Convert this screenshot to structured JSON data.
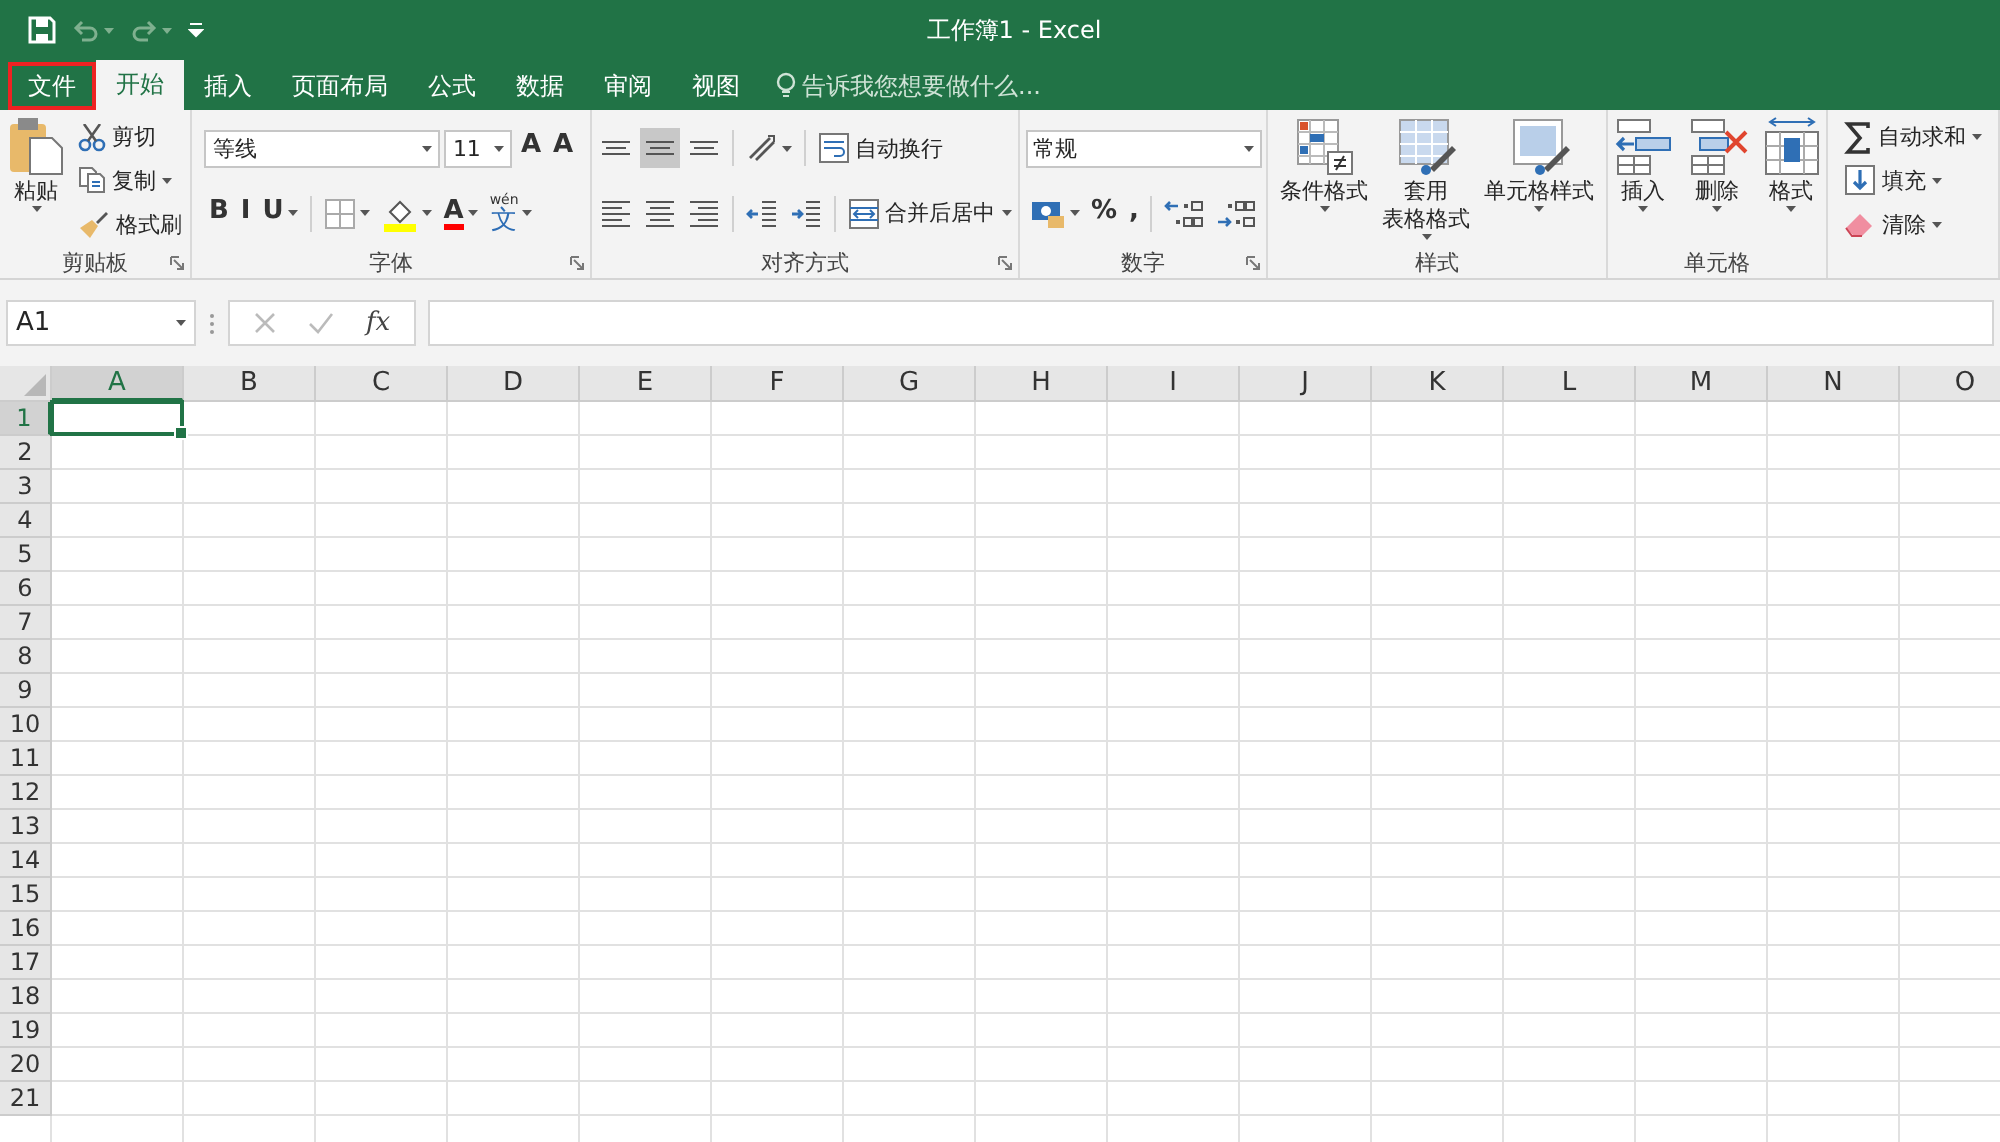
{
  "title_bar": {
    "title": "工作簿1 - Excel",
    "undo_disabled": true,
    "redo_disabled": true
  },
  "tabs": [
    {
      "label": "文件",
      "selected": false,
      "highlighted": true
    },
    {
      "label": "开始",
      "selected": true,
      "highlighted": false
    },
    {
      "label": "插入",
      "selected": false,
      "highlighted": false
    },
    {
      "label": "页面布局",
      "selected": false,
      "highlighted": false
    },
    {
      "label": "公式",
      "selected": false,
      "highlighted": false
    },
    {
      "label": "数据",
      "selected": false,
      "highlighted": false
    },
    {
      "label": "审阅",
      "selected": false,
      "highlighted": false
    },
    {
      "label": "视图",
      "selected": false,
      "highlighted": false
    }
  ],
  "tell_me": {
    "placeholder": "告诉我您想要做什么..."
  },
  "ribbon": [
    {
      "label": "剪贴板",
      "launcher": true,
      "columns": [
        {
          "kind": "large",
          "label": "粘贴",
          "dropdown": true
        },
        {
          "kind": "stack",
          "lines": [
            [
              {
                "kind": "small",
                "label": "剪切",
                "dropdown": false
              }
            ],
            [
              {
                "kind": "small",
                "label": "复制",
                "dropdown": true
              }
            ],
            [
              {
                "kind": "small",
                "label": "格式刷",
                "dropdown": false
              }
            ]
          ]
        }
      ]
    },
    {
      "label": "字体",
      "launcher": true,
      "columns": [
        {
          "kind": "stack",
          "lines": [
            [
              {
                "kind": "field",
                "value": "等线",
                "dropdown": true,
                "wide": true
              },
              {
                "kind": "field",
                "value": "11",
                "dropdown": true,
                "wide": false
              },
              {
                "kind": "glyph",
                "text": "A",
                "dropdown": false
              },
              {
                "kind": "glyph",
                "text": "A",
                "dropdown": false
              }
            ],
            [
              {
                "kind": "glyph",
                "text": "B",
                "dropdown": false
              },
              {
                "kind": "glyph",
                "text": "I",
                "dropdown": false
              },
              {
                "kind": "glyph",
                "text": "U",
                "dropdown": true
              },
              {
                "kind": "separator"
              },
              {
                "kind": "icon",
                "dropdown": true
              },
              {
                "kind": "icon",
                "dropdown": true,
                "color": "#ffff00"
              },
              {
                "kind": "glyph",
                "text": "A",
                "dropdown": true,
                "color": "#ff0000"
              },
              {
                "kind": "ruby",
                "text": "文",
                "ruby": "wén",
                "dropdown": true
              }
            ]
          ]
        }
      ]
    },
    {
      "label": "对齐方式",
      "launcher": true,
      "columns": [
        {
          "kind": "stack",
          "lines": [
            [
              {
                "kind": "icon",
                "dropdown": false,
                "selected": false
              },
              {
                "kind": "icon",
                "dropdown": false,
                "selected": true
              },
              {
                "kind": "icon",
                "dropdown": false,
                "selected": false
              },
              {
                "kind": "separator"
              },
              {
                "kind": "icon",
                "dropdown": true
              },
              {
                "kind": "separator"
              },
              {
                "kind": "small",
                "label": "自动换行",
                "dropdown": false
              }
            ],
            [
              {
                "kind": "icon",
                "dropdown": false,
                "selected": false
              },
              {
                "kind": "icon",
                "dropdown": false,
                "selected": false
              },
              {
                "kind": "icon",
                "dropdown": false,
                "selected": false
              },
              {
                "kind": "separator"
              },
              {
                "kind": "icon",
                "dropdown": false
              },
              {
                "kind": "icon",
                "dropdown": false
              },
              {
                "kind": "separator"
              },
              {
                "kind": "small",
                "label": "合并后居中",
                "dropdown": true
              }
            ]
          ]
        }
      ]
    },
    {
      "label": "数字",
      "launcher": true,
      "columns": [
        {
          "kind": "stack",
          "lines": [
            [
              {
                "kind": "field",
                "value": "常规",
                "dropdown": true,
                "wide": true
              }
            ],
            [
              {
                "kind": "icon",
                "dropdown": true
              },
              {
                "kind": "glyph",
                "text": "%",
                "dropdown": false
              },
              {
                "kind": "glyph",
                "text": ",",
                "dropdown": false
              },
              {
                "kind": "separator"
              },
              {
                "kind": "icon",
                "dropdown": false
              },
              {
                "kind": "icon",
                "dropdown": false
              }
            ]
          ]
        }
      ]
    },
    {
      "label": "样式",
      "launcher": false,
      "columns": [
        {
          "kind": "large",
          "label": "条件格式",
          "dropdown": true
        },
        {
          "kind": "large",
          "label": "套用",
          "label_2": "表格格式",
          "dropdown": true
        },
        {
          "kind": "large",
          "label": "单元格样式",
          "dropdown": true
        }
      ]
    },
    {
      "label": "单元格",
      "launcher": false,
      "columns": [
        {
          "kind": "large",
          "label": "插入",
          "dropdown": true
        },
        {
          "kind": "large",
          "label": "删除",
          "dropdown": true
        },
        {
          "kind": "large",
          "label": "格式",
          "dropdown": true
        }
      ]
    },
    {
      "launcher": false,
      "columns": [
        {
          "kind": "stack",
          "lines": [
            [
              {
                "kind": "small",
                "label": "自动求和",
                "dropdown": true
              }
            ],
            [
              {
                "kind": "small",
                "label": "填充",
                "dropdown": true
              }
            ],
            [
              {
                "kind": "small",
                "label": "清除",
                "dropdown": true
              }
            ]
          ]
        }
      ]
    }
  ],
  "formula_bar": {
    "name_box": "A1",
    "function_label": "fx",
    "cancel_disabled": true,
    "enter_disabled": true
  },
  "grid": {
    "columns": [
      {
        "label": "A",
        "selected": true
      },
      {
        "label": "B",
        "selected": false
      },
      {
        "label": "C",
        "selected": false
      },
      {
        "label": "D",
        "selected": false
      },
      {
        "label": "E",
        "selected": false
      },
      {
        "label": "F",
        "selected": false
      },
      {
        "label": "G",
        "selected": false
      },
      {
        "label": "H",
        "selected": false
      },
      {
        "label": "I",
        "selected": false
      },
      {
        "label": "J",
        "selected": false
      },
      {
        "label": "K",
        "selected": false
      },
      {
        "label": "L",
        "selected": false
      },
      {
        "label": "M",
        "selected": false
      },
      {
        "label": "N",
        "selected": false
      },
      {
        "label": "O",
        "selected": false
      }
    ],
    "rows": [
      {
        "label": "1",
        "selected": true
      },
      {
        "label": "2",
        "selected": false
      },
      {
        "label": "3",
        "selected": false
      },
      {
        "label": "4",
        "selected": false
      },
      {
        "label": "5",
        "selected": false
      },
      {
        "label": "6",
        "selected": false
      },
      {
        "label": "7",
        "selected": false
      },
      {
        "label": "8",
        "selected": false
      },
      {
        "label": "9",
        "selected": false
      },
      {
        "label": "10",
        "selected": false
      },
      {
        "label": "11",
        "selected": false
      },
      {
        "label": "12",
        "selected": false
      },
      {
        "label": "13",
        "selected": false
      },
      {
        "label": "14",
        "selected": false
      },
      {
        "label": "15",
        "selected": false
      },
      {
        "label": "16",
        "selected": false
      },
      {
        "label": "17",
        "selected": false
      },
      {
        "label": "18",
        "selected": false
      },
      {
        "label": "19",
        "selected": false
      },
      {
        "label": "20",
        "selected": false
      },
      {
        "label": "21",
        "selected": false
      }
    ]
  }
}
